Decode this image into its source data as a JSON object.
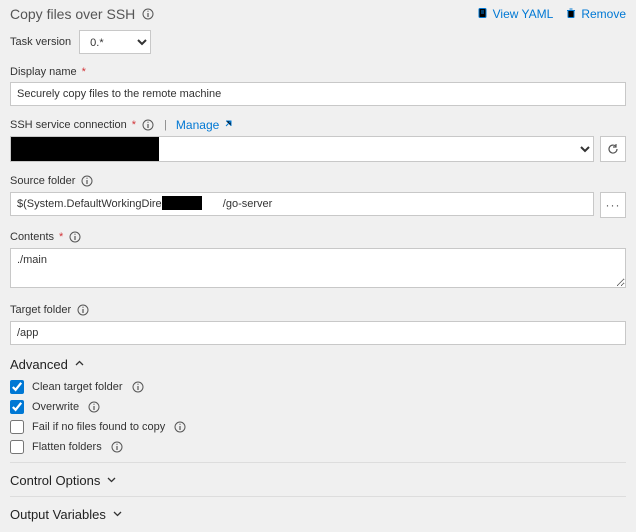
{
  "header": {
    "title": "Copy files over SSH",
    "view_yaml": "View YAML",
    "remove": "Remove"
  },
  "task_version": {
    "label": "Task version",
    "value": "0.*"
  },
  "display_name": {
    "label": "Display name",
    "value": "Securely copy files to the remote machine"
  },
  "ssh": {
    "label": "SSH service connection",
    "manage": "Manage",
    "value": ""
  },
  "source_folder": {
    "label": "Source folder",
    "value_prefix": "$(System.DefaultWorkingDirectory)/",
    "value_suffix": "/go-server"
  },
  "contents": {
    "label": "Contents",
    "value": "./main"
  },
  "target_folder": {
    "label": "Target folder",
    "value": "/app"
  },
  "advanced": {
    "title": "Advanced",
    "clean": {
      "label": "Clean target folder",
      "checked": true
    },
    "overwrite": {
      "label": "Overwrite",
      "checked": true
    },
    "fail": {
      "label": "Fail if no files found to copy",
      "checked": false
    },
    "flatten": {
      "label": "Flatten folders",
      "checked": false
    }
  },
  "control_options": "Control Options",
  "output_variables": "Output Variables"
}
